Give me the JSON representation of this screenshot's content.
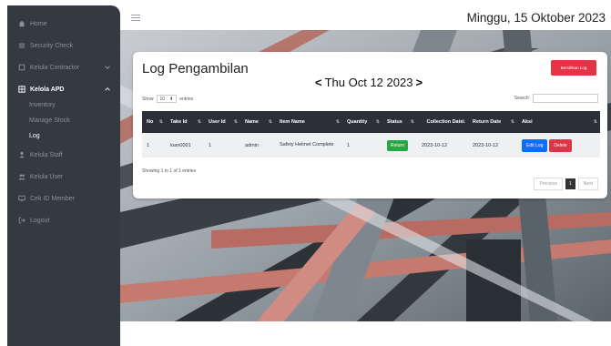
{
  "date_header": "Minggu, 15 Oktober 2023",
  "sidebar": {
    "items": [
      {
        "label": "Home",
        "icon": "home-icon"
      },
      {
        "label": "Security Check",
        "icon": "list-icon"
      },
      {
        "label": "Kelola Contractor",
        "icon": "building-icon"
      },
      {
        "label": "Kelola APD",
        "icon": "grid-icon"
      },
      {
        "label": "Kelola Staff",
        "icon": "person-icon"
      },
      {
        "label": "Kelola User",
        "icon": "users-icon"
      },
      {
        "label": "Cek ID Member",
        "icon": "monitor-icon"
      },
      {
        "label": "Logout",
        "icon": "logout-icon"
      }
    ],
    "apd_sub": [
      {
        "label": "Inventory"
      },
      {
        "label": "Manage Stock"
      },
      {
        "label": "Log"
      }
    ]
  },
  "card": {
    "title": "Log Pengambilan",
    "top_button": "Bersihkan Log",
    "date_nav": "Thu Oct 12 2023",
    "show_prefix": "Show",
    "show_value": "10",
    "show_suffix": "entries",
    "search_label": "Search:",
    "search_value": "",
    "columns": [
      "No",
      "Take Id",
      "User Id",
      "Name",
      "Item Name",
      "Quantity",
      "Status",
      "Collection Date",
      "Return Date",
      "Aksi"
    ],
    "rows": [
      {
        "no": "1",
        "take_id": "loan0001",
        "user_id": "1",
        "name": "admin",
        "item_name": "Safety Helmet Complete",
        "quantity": "1",
        "status": "Return",
        "collection_date": "2023-10-12",
        "return_date": "2023-10-12",
        "edit": "Edit Log",
        "delete": "Delete"
      }
    ],
    "info": "Showing 1 to 1 of 1 entries",
    "pager": {
      "previous": "Previous",
      "current": "1",
      "next": "Next"
    }
  },
  "colors": {
    "sidebar": "#343a40",
    "danger": "#e33346",
    "success": "#28a745",
    "primary": "#0d6efd",
    "table_head": "#2c3036"
  }
}
